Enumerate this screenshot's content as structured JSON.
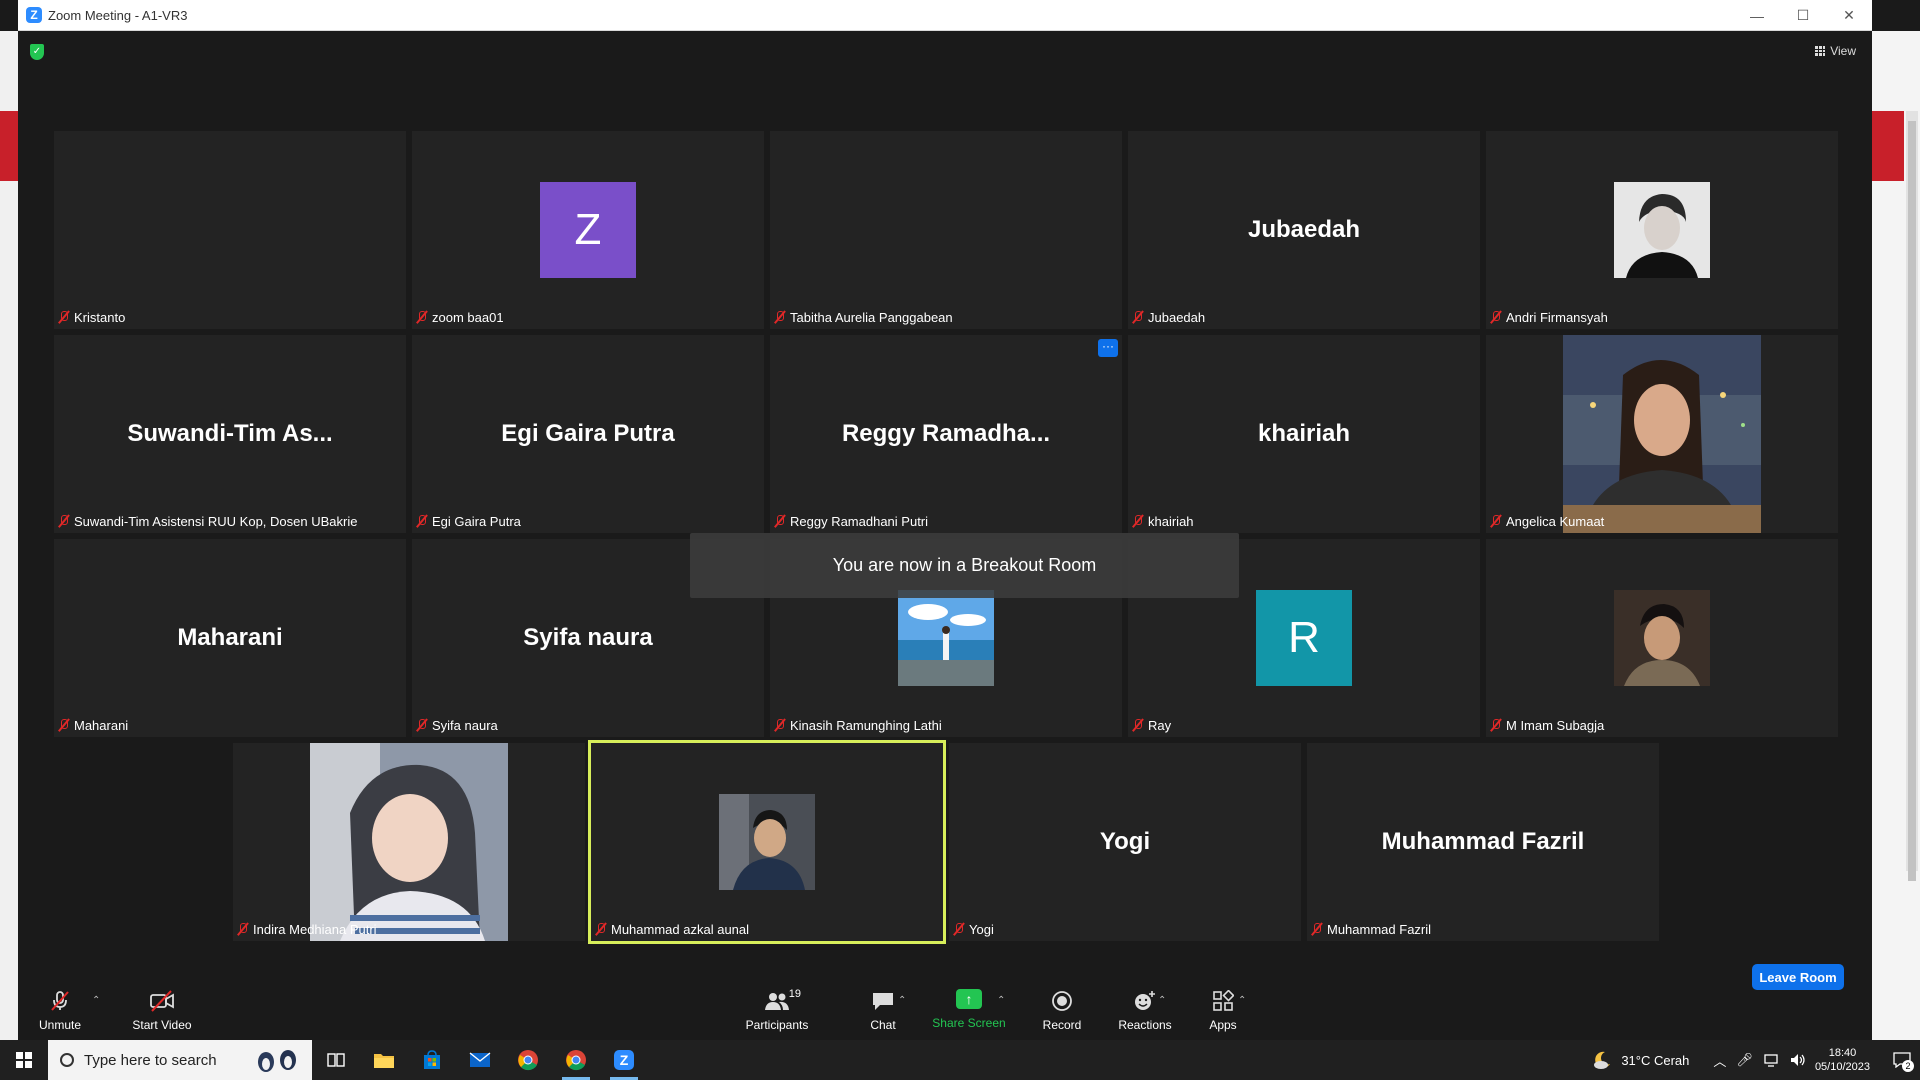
{
  "window": {
    "title": "Zoom Meeting - A1-VR3"
  },
  "top_bar": {
    "view_label": "View"
  },
  "participants": [
    {
      "name": "Kristanto",
      "display": ""
    },
    {
      "name": "zoom baa01",
      "avatar_letter": "Z",
      "avatar_color": "#7a4fc9"
    },
    {
      "name": "Tabitha Aurelia Panggabean",
      "display": ""
    },
    {
      "name": "Jubaedah",
      "display": "Jubaedah"
    },
    {
      "name": "Andri Firmansyah"
    },
    {
      "name": "Suwandi-Tim Asistensi RUU Kop, Dosen UBakrie",
      "display": "Suwandi-Tim  As..."
    },
    {
      "name": "Egi Gaira Putra",
      "display": "Egi Gaira Putra"
    },
    {
      "name": "Reggy Ramadhani Putri",
      "display": "Reggy  Ramadha...",
      "more": "···"
    },
    {
      "name": "khairiah",
      "display": "khairiah"
    },
    {
      "name": "Angelica Kumaat"
    },
    {
      "name": "Maharani",
      "display": "Maharani"
    },
    {
      "name": "Syifa naura",
      "display": "Syifa naura"
    },
    {
      "name": "Kinasih Ramunghing Lathi"
    },
    {
      "name": "Ray",
      "avatar_letter": "R",
      "avatar_color": "#1296a8"
    },
    {
      "name": "M Imam Subagja"
    },
    {
      "name": "Indira Medhiana Putri"
    },
    {
      "name": "Muhammad azkal aunal"
    },
    {
      "name": "Yogi",
      "display": "Yogi"
    },
    {
      "name": "Muhammad Fazril",
      "display": "Muhammad Fazril"
    }
  ],
  "toast": "You are now in a Breakout Room",
  "toolbar": {
    "unmute": "Unmute",
    "start_video": "Start Video",
    "participants": "Participants",
    "participant_count": "19",
    "chat": "Chat",
    "share_screen": "Share Screen",
    "record": "Record",
    "reactions": "Reactions",
    "apps": "Apps",
    "leave_room": "Leave Room"
  },
  "taskbar": {
    "search_placeholder": "Type here to search",
    "weather": "31°C  Cerah",
    "time": "18:40",
    "date": "05/10/2023",
    "notifications": "2"
  },
  "colors": {
    "accent": "#0e71eb",
    "active_speaker": "#d7ee5a",
    "share_green": "#23c552",
    "mute_red": "#e02828"
  }
}
